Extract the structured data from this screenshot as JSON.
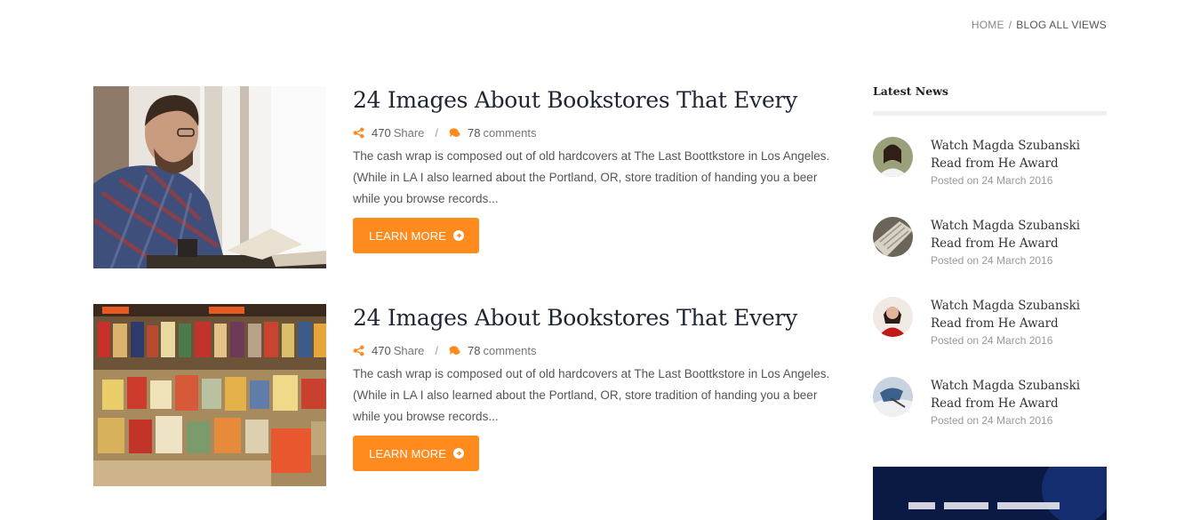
{
  "breadcrumb": {
    "home": "HOME",
    "separator": "/",
    "current": "BLOG ALL VIEWS"
  },
  "posts": [
    {
      "title": "24 Images About Bookstores That Every",
      "share_count": "470",
      "share_label": "Share",
      "comment_count": "78",
      "comment_label": "comments",
      "excerpt": "The cash wrap is composed out of old hardcovers at The Last Boottkstore in Los Angeles. (While in LA I also learned about the Portland, OR, store tradition of handing you a beer while you browse records...",
      "button": "LEARN MORE"
    },
    {
      "title": "24 Images About Bookstores That Every",
      "share_count": "470",
      "share_label": "Share",
      "comment_count": "78",
      "comment_label": "comments",
      "excerpt": "The cash wrap is composed out of old hardcovers at The Last Boottkstore in Los Angeles. (While in LA I also learned about the Portland, OR, store tradition of handing you a beer while you browse records...",
      "button": "LEARN MORE"
    }
  ],
  "sidebar": {
    "heading": "Latest News",
    "items": [
      {
        "title": "Watch Magda Szubanski Read from He Award",
        "date": "Posted on 24 March 2016"
      },
      {
        "title": "Watch Magda Szubanski Read from He Award",
        "date": "Posted on 24 March 2016"
      },
      {
        "title": "Watch Magda Szubanski Read from He Award",
        "date": "Posted on 24 March 2016"
      },
      {
        "title": "Watch Magda Szubanski Read from He Award",
        "date": "Posted on 24 March 2016"
      }
    ]
  },
  "colors": {
    "accent": "#ff8a1d",
    "heading": "#1f2532",
    "muted": "#999999"
  },
  "icons": {
    "share": "share-icon",
    "comments": "comments-icon",
    "arrow": "arrow-circle-right-icon"
  }
}
